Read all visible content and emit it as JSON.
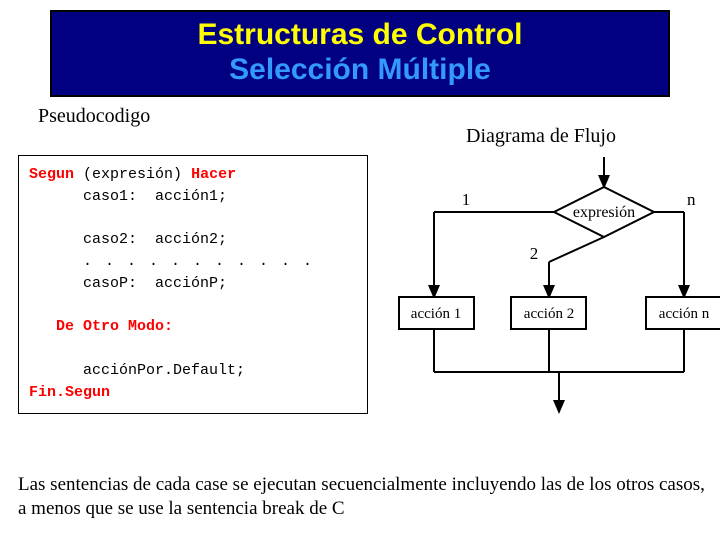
{
  "title": {
    "line1": "Estructuras de Control",
    "line2": "Selección Múltiple"
  },
  "headers": {
    "pseudo": "Pseudocodigo",
    "flow": "Diagrama de Flujo"
  },
  "code": {
    "kw_segun": "Segun",
    "paren": "(expresión)",
    "kw_hacer": "Hacer",
    "case1_label": "caso1:",
    "case1_action": "acción1;",
    "case2_label": "caso2:",
    "case2_action": "acción2;",
    "ellipsis": ". . . . . . . . . . .",
    "caseP_label": "casoP:",
    "caseP_action": "acciónP;",
    "kw_default": "De Otro Modo:",
    "default_action": "acciónPor.Default;",
    "kw_end": "Fin.Segun"
  },
  "diagram": {
    "decision": "expresión",
    "branch1": "1",
    "branch2": "2",
    "branchN": "n",
    "action1": "acción 1",
    "action2": "acción 2",
    "actionN": "acción n"
  },
  "footnote": "Las sentencias de cada case se ejecutan secuencialmente incluyendo las de los otros casos, a menos que se use la sentencia break de  C"
}
